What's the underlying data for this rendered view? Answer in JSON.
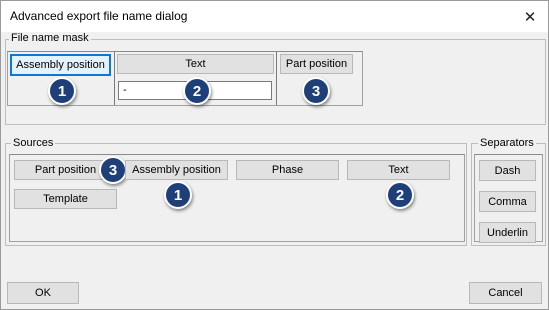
{
  "window": {
    "title": "Advanced export file name dialog"
  },
  "mask": {
    "label": "File name mask",
    "slots": [
      {
        "label": "Assembly position",
        "badge": "1"
      },
      {
        "label": "Text",
        "value": "-",
        "badge": "2"
      },
      {
        "label": "Part position",
        "badge": "3"
      }
    ]
  },
  "sources": {
    "label": "Sources",
    "items": [
      {
        "label": "Part position",
        "badge": "3"
      },
      {
        "label": "Assembly position",
        "badge": "1"
      },
      {
        "label": "Phase"
      },
      {
        "label": "Text",
        "badge": "2"
      },
      {
        "label": "Template"
      }
    ]
  },
  "separators": {
    "label": "Separators",
    "items": [
      "Dash",
      "Comma",
      "Underlin"
    ]
  },
  "footer": {
    "ok_label": "OK",
    "cancel_label": "Cancel"
  },
  "colors": {
    "badge": "#1f3f79",
    "selected_border": "#0a78d7"
  }
}
